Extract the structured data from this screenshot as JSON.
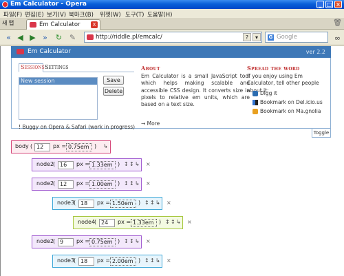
{
  "window": {
    "title": "Em Calculator - Opera"
  },
  "menu": [
    "파일(F)",
    "편집(E)",
    "보기(V)",
    "북마크(B)",
    "위젯(W)",
    "도구(T)",
    "도움말(H)"
  ],
  "tabs": {
    "new_tab": "새 탭",
    "active_tab": "Em Calculator"
  },
  "address": {
    "url": "http://riddle.pl/emcalc/",
    "search_placeholder": "Google"
  },
  "app": {
    "title": "Em Calculator",
    "version": "ver 2.2",
    "tab_sessions": "Sessions",
    "tab_settings": "Settings",
    "session_selected": "New session",
    "save": "Save",
    "delete": "Delete",
    "warning": "! Buggy on Opera & Safari (work in progress)",
    "about_title": "About",
    "about_text": "Em Calculator is a small JavaScript tool which helps making scalable and accessible CSS design. It converts size in pixels to relative em units, which are based on a text size.",
    "more": "→ More",
    "spread_title": "Spread the word",
    "spread_text": "If you enjoy using Em Calculator, tell other people about it:",
    "links": [
      "Digg it",
      "Bookmark on Del.icio.us",
      "Bookmark on Ma.gnolia"
    ],
    "toggle": "Toggle"
  },
  "nodes": [
    {
      "name": "body",
      "px": "12",
      "em": "0.75em",
      "color": "body"
    },
    {
      "name": "node2",
      "px": "16",
      "em": "1.33em",
      "color": "node2"
    },
    {
      "name": "node2",
      "px": "12",
      "em": "1.00em",
      "color": "node2"
    },
    {
      "name": "node3",
      "px": "18",
      "em": "1.50em",
      "color": "node3"
    },
    {
      "name": "node4",
      "px": "24",
      "em": "1.33em",
      "color": "node4"
    },
    {
      "name": "node2",
      "px": "9",
      "em": "0.75em",
      "color": "node2"
    },
    {
      "name": "node3",
      "px": "18",
      "em": "2.00em",
      "color": "node3"
    }
  ],
  "labels": {
    "paren_open": "(",
    "paren_close": ")",
    "px_eq": "px =",
    "close_x": "×"
  },
  "colors": {
    "body": "#d6487a",
    "node2": "#a05ad0",
    "node3": "#3fa8d8",
    "node4": "#a8c840",
    "header": "#3e78b7",
    "accent": "#c03030"
  }
}
